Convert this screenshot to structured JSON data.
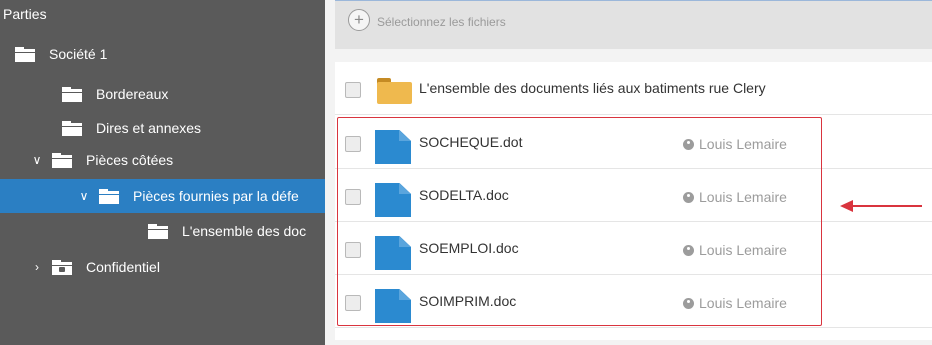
{
  "sidebar": {
    "title": "Parties",
    "items": [
      {
        "label": "Société 1"
      },
      {
        "label": "Bordereaux"
      },
      {
        "label": "Dires et annexes"
      },
      {
        "label": "Pièces côtées"
      },
      {
        "label": "Pièces fournies par la défe"
      },
      {
        "label": "L'ensemble des doc"
      },
      {
        "label": "Confidentiel"
      }
    ]
  },
  "toolbar": {
    "add_icon": "+",
    "add_label": "Sélectionnez les fichiers"
  },
  "list": {
    "folder_row": {
      "name": "L'ensemble des documents liés aux batiments rue Clery"
    },
    "files": [
      {
        "name": "SOCHEQUE.dot",
        "owner": "Louis Lemaire"
      },
      {
        "name": "SODELTA.doc",
        "owner": "Louis Lemaire"
      },
      {
        "name": "SOEMPLOI.doc",
        "owner": "Louis Lemaire"
      },
      {
        "name": "SOIMPRIM.doc",
        "owner": "Louis Lemaire"
      }
    ]
  },
  "colors": {
    "sidebar_bg": "#5a5a5a",
    "selected_bg": "#2b7fc3",
    "doc_icon": "#2b8ad0",
    "folder_icon": "#efb94e",
    "annotation": "#d9343e"
  }
}
